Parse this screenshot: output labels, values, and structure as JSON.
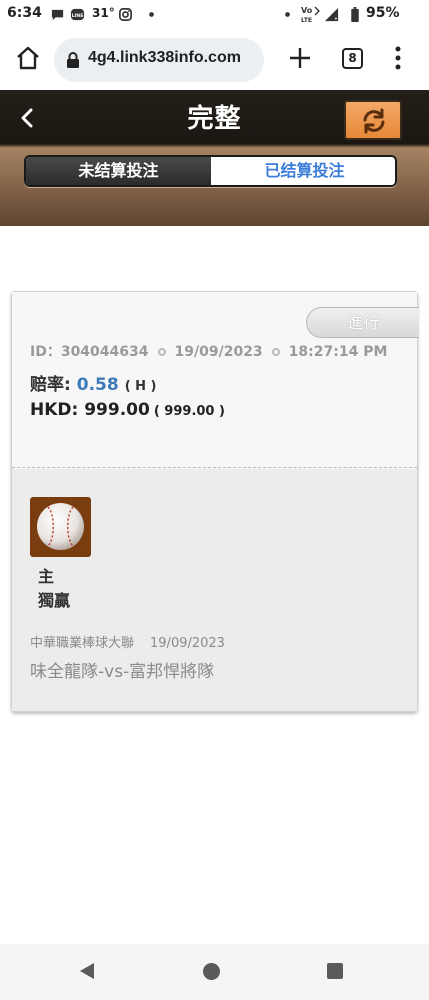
{
  "status_bar": {
    "time": "6:34",
    "temperature": "31°",
    "battery_percent": "95%",
    "icons": [
      "chat-bubble-icon",
      "line-app-icon",
      "instagram-icon",
      "dot-icon",
      "wifi-calling-icon",
      "signal-icon",
      "battery-icon"
    ]
  },
  "browser": {
    "url": "4g4.link338info.com",
    "tab_count": "8"
  },
  "app": {
    "title": "完整",
    "tabs": [
      {
        "label": "未结算投注",
        "active": false
      },
      {
        "label": "已结算投注",
        "active": true
      }
    ],
    "accent_color": "#e58938",
    "active_tab_color": "#3b7dd8"
  },
  "bet": {
    "status": "進行",
    "id_text": "ID：304044634",
    "date": "19/09/2023",
    "time": "18:27:14 PM",
    "odds_label": "赔率:",
    "odds_value": "0.58",
    "odds_type": "( H )",
    "amount_text": "HKD: 999.00",
    "amount_sub": "( 999.00 )",
    "side": "主",
    "bet_type": "獨贏",
    "league": "中華職業棒球大聯",
    "match_date": "19/09/2023",
    "match": "味全龍隊-vs-富邦悍將隊"
  }
}
